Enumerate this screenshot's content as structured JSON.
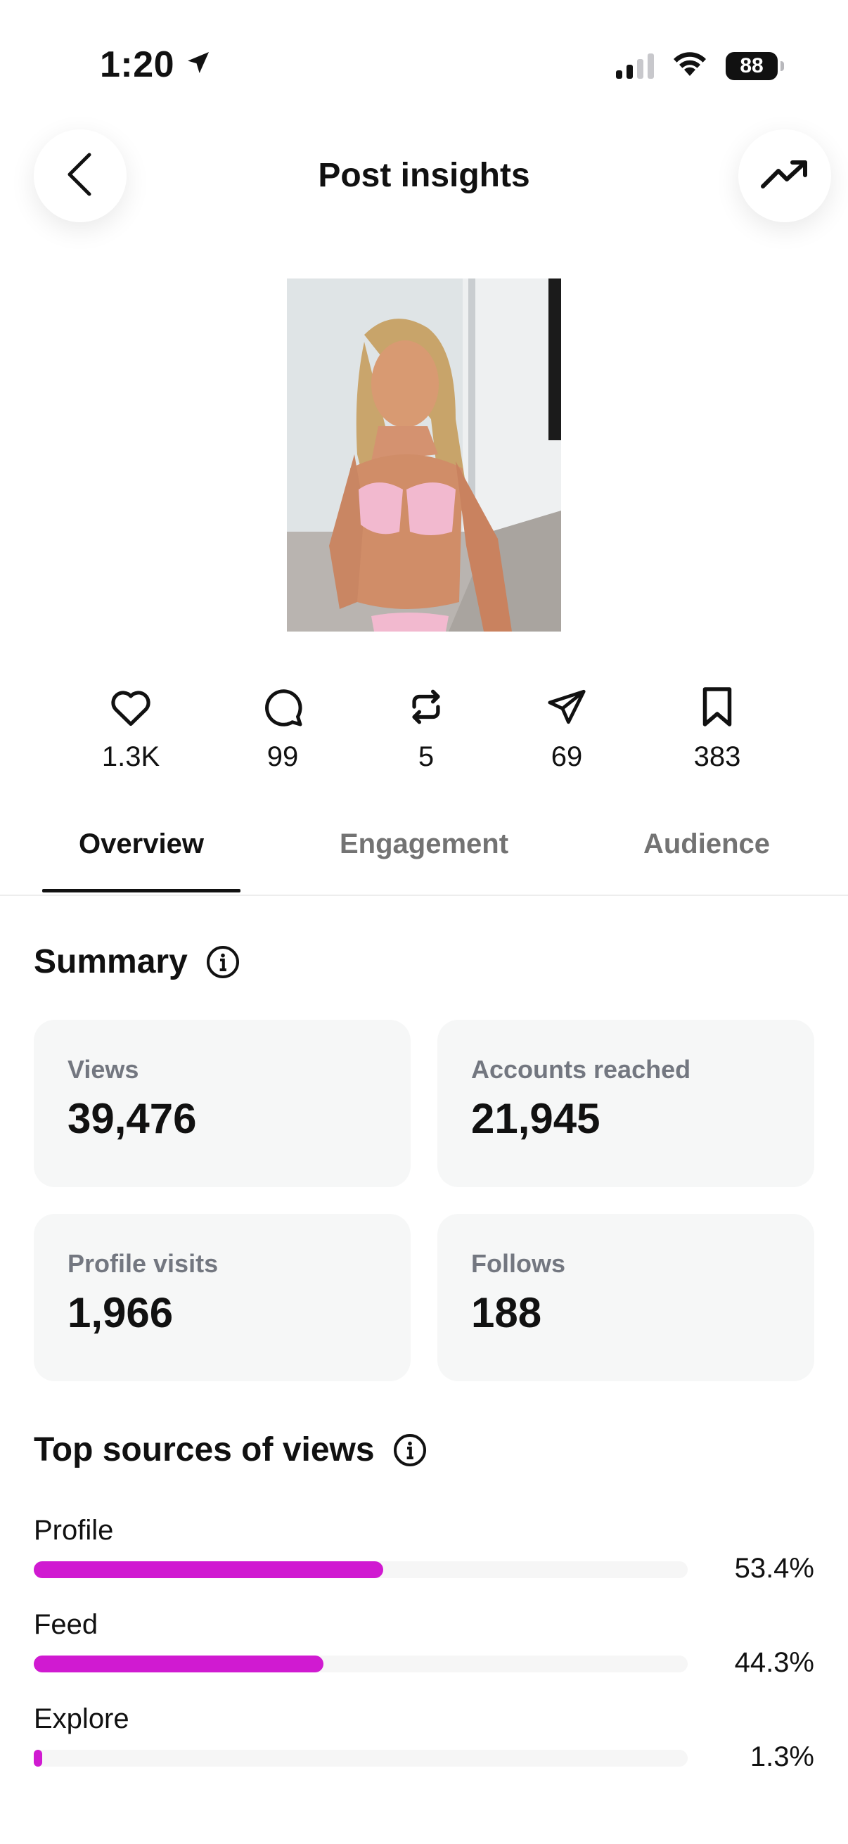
{
  "status_bar": {
    "time": "1:20",
    "battery": "88",
    "location_icon": "location-arrow-icon",
    "signal_icon": "cellular-signal-icon",
    "wifi_icon": "wifi-icon"
  },
  "header": {
    "title": "Post insights",
    "back_icon": "chevron-left-icon",
    "trend_icon": "trending-up-icon"
  },
  "post": {
    "image_alt": "post-photo"
  },
  "metrics": [
    {
      "icon": "heart-icon",
      "value": "1.3K"
    },
    {
      "icon": "comment-icon",
      "value": "99"
    },
    {
      "icon": "repost-icon",
      "value": "5"
    },
    {
      "icon": "share-icon",
      "value": "69"
    },
    {
      "icon": "bookmark-icon",
      "value": "383"
    }
  ],
  "tabs": [
    {
      "label": "Overview",
      "active": true
    },
    {
      "label": "Engagement",
      "active": false
    },
    {
      "label": "Audience",
      "active": false
    }
  ],
  "summary": {
    "title": "Summary",
    "cards": [
      {
        "label": "Views",
        "value": "39,476"
      },
      {
        "label": "Accounts reached",
        "value": "21,945"
      },
      {
        "label": "Profile visits",
        "value": "1,966"
      },
      {
        "label": "Follows",
        "value": "188"
      }
    ]
  },
  "top_sources": {
    "title": "Top sources of views",
    "accent_color": "#d01ad1",
    "items": [
      {
        "name": "Profile",
        "percent_label": "53.4%",
        "fraction": 0.534
      },
      {
        "name": "Feed",
        "percent_label": "44.3%",
        "fraction": 0.443
      },
      {
        "name": "Explore",
        "percent_label": "1.3%",
        "fraction": 0.013
      }
    ]
  }
}
